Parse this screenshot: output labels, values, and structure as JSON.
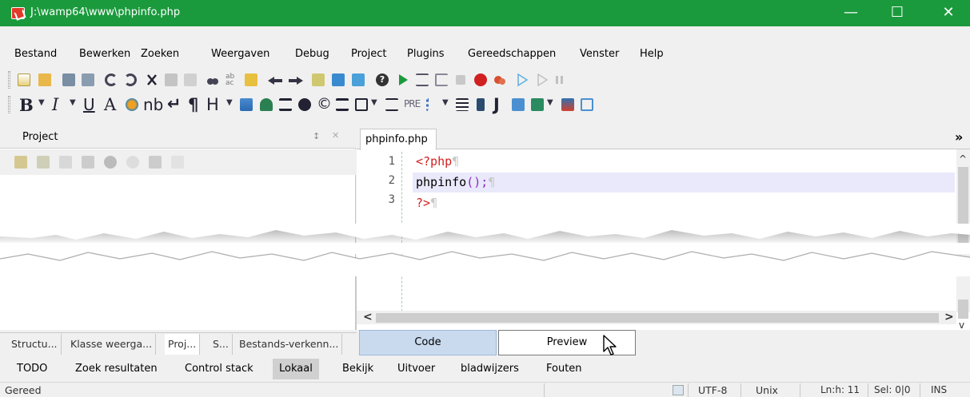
{
  "window": {
    "title": "J:\\wamp64\\www\\phpinfo.php",
    "minimize": "—",
    "maximize": "☐",
    "close": "✕",
    "titlebar_color": "#1a9a3c"
  },
  "menu": [
    "Bestand",
    "Bewerken",
    "Zoeken",
    "Weergaven",
    "Debug",
    "Project",
    "Plugins",
    "Gereedschappen",
    "Venster",
    "Help"
  ],
  "format_toolbar": {
    "bold": "B",
    "italic": "I",
    "underline": "U",
    "font": "A",
    "nbsp": "nb",
    "pilcrow": "¶",
    "heading": "H",
    "pre": "PRE",
    "java": "J"
  },
  "project_panel": {
    "title": "Project",
    "pin": "↕",
    "close": "✕"
  },
  "editor": {
    "tab_label": "phpinfo.php",
    "overflow": "»",
    "lines": [
      {
        "num": "1",
        "parts": [
          {
            "text": "<?php",
            "cls": "red"
          }
        ]
      },
      {
        "num": "2",
        "parts": [
          {
            "text": "phpinfo",
            "cls": ""
          },
          {
            "text": "();",
            "cls": "purple"
          }
        ]
      },
      {
        "num": "3",
        "parts": [
          {
            "text": "?>",
            "cls": "red"
          }
        ]
      }
    ],
    "scroll_left": "<",
    "scroll_right": ">",
    "scroll_up": "^",
    "scroll_down": "v"
  },
  "side_tabs": [
    "Structu...",
    "Klasse weerga...",
    "Proj...",
    "S...",
    "Bestands-verkenn..."
  ],
  "view_buttons": {
    "code": "Code",
    "preview": "Preview"
  },
  "bottom_tabs": [
    "TODO",
    "Zoek resultaten",
    "Control stack",
    "Lokaal",
    "Bekijk",
    "Uitvoer",
    "bladwijzers",
    "Fouten"
  ],
  "active_bottom_tab": "Lokaal",
  "status": {
    "state": "Gereed",
    "encoding": "UTF-8",
    "line_endings": "Unix",
    "position": "Ln:h: 11",
    "selection": "Sel: 0|0",
    "mode": "INS"
  }
}
